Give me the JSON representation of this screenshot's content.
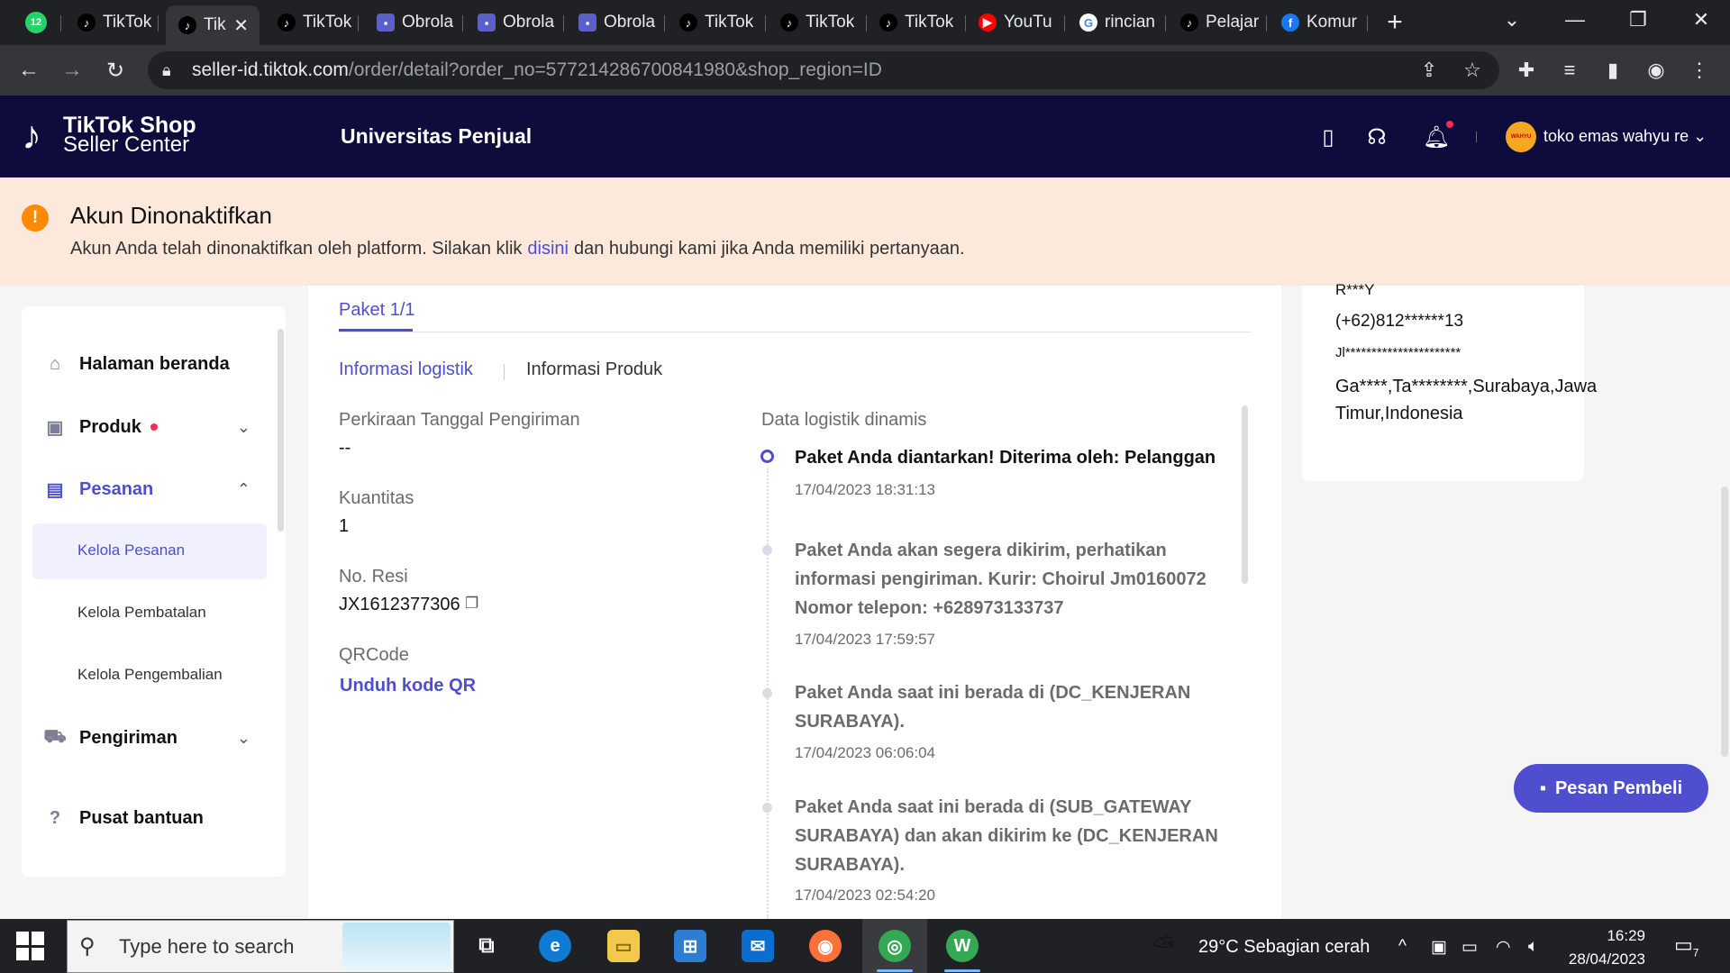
{
  "browser": {
    "tabs": [
      {
        "label": "",
        "icon": "whatsapp-icon",
        "badge": "12"
      },
      {
        "label": "TikTok",
        "icon": "tiktok-icon"
      },
      {
        "label": "Tik",
        "icon": "tiktok-icon",
        "active": true
      },
      {
        "label": "TikTok",
        "icon": "tiktok-icon"
      },
      {
        "label": "Obrola",
        "icon": "chat-icon"
      },
      {
        "label": "Obrola",
        "icon": "chat-icon"
      },
      {
        "label": "Obrola",
        "icon": "chat-icon"
      },
      {
        "label": "TikTok",
        "icon": "tiktok-icon"
      },
      {
        "label": "TikTok",
        "icon": "tiktok-icon"
      },
      {
        "label": "TikTok",
        "icon": "tiktok-icon"
      },
      {
        "label": "YouTu",
        "icon": "youtube-icon"
      },
      {
        "label": "rincian",
        "icon": "google-icon"
      },
      {
        "label": "Pelajar",
        "icon": "tiktok-icon"
      },
      {
        "label": "Komur",
        "icon": "facebook-icon"
      }
    ],
    "url_host": "seller-id.tiktok.com",
    "url_path": "/order/detail?order_no=577214286700841980&shop_region=ID"
  },
  "header": {
    "logo_line1": "TikTok Shop",
    "logo_line2": "Seller Center",
    "section_title": "Universitas Penjual",
    "shop_name": "toko emas wahyu re"
  },
  "banner": {
    "title": "Akun Dinonaktifkan",
    "text_before": "Akun Anda telah dinonaktifkan oleh platform. Silakan klik",
    "link": "disini",
    "text_after": "dan hubungi kami jika Anda memiliki pertanyaan."
  },
  "sidebar": {
    "items": [
      {
        "label": "Halaman beranda",
        "icon": "home-icon"
      },
      {
        "label": "Produk",
        "icon": "product-icon"
      },
      {
        "label": "Pesanan",
        "icon": "order-icon"
      },
      {
        "label": "Pengiriman",
        "icon": "truck-icon"
      },
      {
        "label": "Pusat bantuan",
        "icon": "help-icon"
      }
    ],
    "sub_items": [
      "Kelola Pesanan",
      "Kelola Pembatalan",
      "Kelola Pengembalian"
    ]
  },
  "main": {
    "package_tab": "Paket 1/1",
    "subtabs": [
      "Informasi logistik",
      "Informasi Produk"
    ],
    "fields": [
      {
        "label": "Perkiraan Tanggal Pengiriman",
        "value": "--"
      },
      {
        "label": "Kuantitas",
        "value": "1"
      },
      {
        "label": "No. Resi",
        "value": "JX1612377306"
      },
      {
        "label": "QRCode",
        "value": "Unduh kode QR"
      }
    ],
    "logistics_title": "Data logistik dinamis",
    "events": [
      {
        "text": "Paket Anda diantarkan! Diterima oleh: Pelanggan",
        "time": "17/04/2023 18:31:13"
      },
      {
        "text": "Paket Anda akan segera dikirim, perhatikan informasi pengiriman. Kurir: Choirul Jm0160072 Nomor telepon: +628973133737",
        "time": "17/04/2023 17:59:57"
      },
      {
        "text": "Paket Anda saat ini berada di (DC_KENJERAN SURABAYA).",
        "time": "17/04/2023 06:06:04"
      },
      {
        "text": "Paket Anda saat ini berada di (SUB_GATEWAY SURABAYA) dan akan dikirim ke (DC_KENJERAN SURABAYA).",
        "time": "17/04/2023 02:54:20"
      }
    ]
  },
  "recipient": {
    "name": "R***Y",
    "phone": "(+62)812******13",
    "street": "Jl**********************",
    "region": "Ga****,Ta********,Surabaya,Jawa Timur,Indonesia"
  },
  "chat_button": "Pesan Pembeli",
  "taskbar": {
    "search_placeholder": "Type here to search",
    "weather": "29°C",
    "weather_desc": "Sebagian cerah",
    "time": "16:29",
    "date": "28/04/2023",
    "notifications": "7"
  }
}
